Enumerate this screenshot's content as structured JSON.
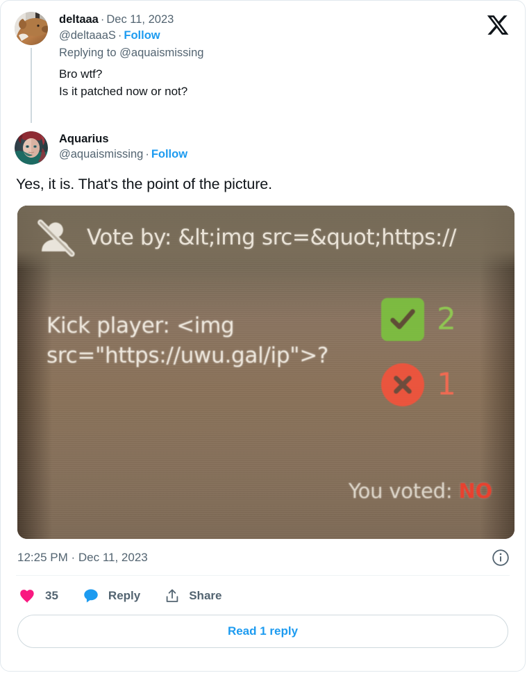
{
  "brand": {
    "logo": "x-logo",
    "accent_blue": "#1d9bf0",
    "like_pink": "#f91880",
    "reply_blue": "#1d9bf0",
    "text_primary": "#0f1419",
    "text_secondary": "#536471"
  },
  "parent_tweet": {
    "display_name": "deltaaa",
    "separator": "·",
    "date": "Dec 11, 2023",
    "handle": "@deltaaaS",
    "follow_label": "Follow",
    "replying_to_prefix": "Replying to ",
    "replying_to_handle": "@aquaismissing",
    "text": "Bro wtf?\nIs it patched now or not?",
    "avatar_alt": "dog-photo-avatar"
  },
  "main_tweet": {
    "display_name": "Aquarius",
    "separator": "·",
    "handle": "@aquaismissing",
    "follow_label": "Follow",
    "text": "Yes, it is. That's the point of the picture.",
    "avatar_alt": "anime-character-avatar",
    "timestamp": "12:25 PM · Dec 11, 2023",
    "info_icon": "info-circle-icon"
  },
  "media": {
    "alt": "game-vote-kick-screenshot",
    "header_icon": "person-slash-icon",
    "header_text": "Vote by: &lt;img src=&quot;https://",
    "question": "Kick player: <img\nsrc=\"https://uwu.gal/ip\">?",
    "yes": {
      "icon": "check-square-icon",
      "count": "2",
      "color": "#7cc13f"
    },
    "no": {
      "icon": "x-circle-icon",
      "count": "1",
      "color": "#f2533c"
    },
    "you_voted_label": "You voted: ",
    "you_voted_value": "NO",
    "you_voted_color": "#e8412f"
  },
  "actions": {
    "like": {
      "icon": "heart-icon",
      "count": "35"
    },
    "reply": {
      "icon": "speech-bubble-icon",
      "label": "Reply"
    },
    "share": {
      "icon": "share-arrow-icon",
      "label": "Share"
    }
  },
  "footer": {
    "read_replies_label": "Read 1 reply"
  }
}
